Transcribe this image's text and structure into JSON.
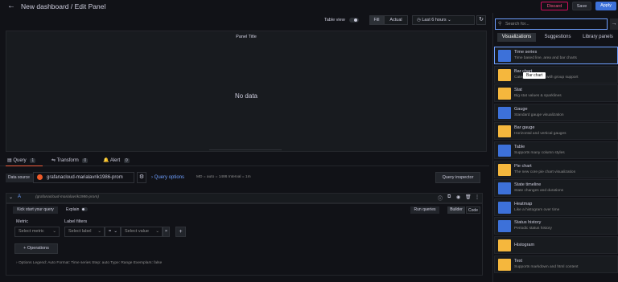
{
  "header": {
    "title": "New dashboard / Edit Panel",
    "discard": "Discard",
    "save": "Save",
    "apply": "Apply"
  },
  "toolbar": {
    "table_view": "Table view",
    "fill": "Fill",
    "actual": "Actual",
    "time_range": "Last 6 hours"
  },
  "panel": {
    "title": "Panel Title",
    "no_data": "No data"
  },
  "tabs": [
    {
      "label": "Query",
      "count": "1"
    },
    {
      "label": "Transform",
      "count": "0"
    },
    {
      "label": "Alert",
      "count": "0"
    }
  ],
  "datasource": {
    "label": "Data source",
    "name": "grafanacloud-marialavrik1986-prom",
    "query_options": "Query options",
    "meta": "MD = auto = 1486   Interval = 1m",
    "inspector": "Query inspector"
  },
  "query": {
    "letter": "A",
    "datasource": "(grafanacloud-marialavrik1986-prom)",
    "kick_start": "Kick start your query",
    "explain": "Explain",
    "run_queries": "Run queries",
    "builder": "Builder",
    "code": "Code",
    "metric_label": "Metric",
    "label_filters_label": "Label filters",
    "select_metric": "Select metric",
    "select_label": "Select label",
    "operator": "=",
    "select_value": "Select value",
    "operations": "Operations",
    "options_line": "Options   Legend: Auto   Format: Time series   Step: auto   Type: Range   Exemplars: false"
  },
  "sidebar": {
    "search_placeholder": "Search for...",
    "tabs": [
      "Visualizations",
      "Suggestions",
      "Library panels"
    ],
    "tooltip": "Bar chart",
    "items": [
      {
        "name": "Time series",
        "desc": "Time based line, area and bar charts",
        "color": "#3d71d9"
      },
      {
        "name": "Bar chart",
        "desc": "Categorical charts with group support",
        "color": "#f5b73d"
      },
      {
        "name": "Stat",
        "desc": "Big stat values & sparklines",
        "color": "#f5b73d"
      },
      {
        "name": "Gauge",
        "desc": "Standard gauge visualization",
        "color": "#3d71d9"
      },
      {
        "name": "Bar gauge",
        "desc": "Horizontal and vertical gauges",
        "color": "#f5b73d"
      },
      {
        "name": "Table",
        "desc": "Supports many column styles",
        "color": "#3d71d9"
      },
      {
        "name": "Pie chart",
        "desc": "The new core pie chart visualization",
        "color": "#f5b73d"
      },
      {
        "name": "State timeline",
        "desc": "State changes and durations",
        "color": "#3d71d9"
      },
      {
        "name": "Heatmap",
        "desc": "Like a histogram over time",
        "color": "#3d71d9"
      },
      {
        "name": "Status history",
        "desc": "Periodic status history",
        "color": "#3d71d9"
      },
      {
        "name": "Histogram",
        "desc": "",
        "color": "#f5b73d"
      },
      {
        "name": "Text",
        "desc": "Supports markdown and html content",
        "color": "#f5b73d"
      }
    ]
  }
}
